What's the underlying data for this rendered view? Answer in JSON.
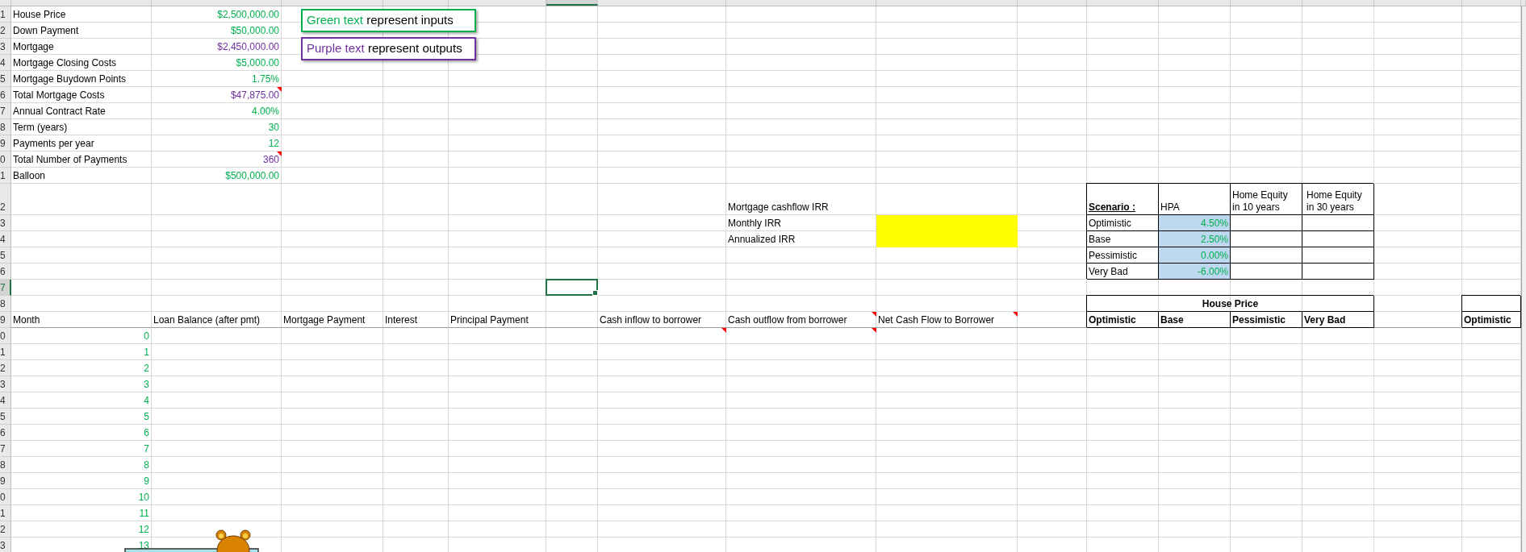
{
  "row_headers": [
    {
      "label": "1",
      "selected": false
    },
    {
      "label": "2",
      "selected": false
    },
    {
      "label": "3",
      "selected": false
    },
    {
      "label": "4",
      "selected": false
    },
    {
      "label": "5",
      "selected": false
    },
    {
      "label": "6",
      "selected": false
    },
    {
      "label": "7",
      "selected": false
    },
    {
      "label": "8",
      "selected": false
    },
    {
      "label": "9",
      "selected": false
    },
    {
      "label": "0",
      "selected": false
    },
    {
      "label": "1",
      "selected": false
    },
    {
      "label": "2",
      "selected": false
    },
    {
      "label": "3",
      "selected": false
    },
    {
      "label": "4",
      "selected": false
    },
    {
      "label": "5",
      "selected": false
    },
    {
      "label": "6",
      "selected": false
    },
    {
      "label": "7",
      "selected": true
    },
    {
      "label": "8",
      "selected": false
    },
    {
      "label": "9",
      "selected": false
    },
    {
      "label": "0",
      "selected": false
    },
    {
      "label": "1",
      "selected": false
    },
    {
      "label": "2",
      "selected": false
    },
    {
      "label": "3",
      "selected": false
    },
    {
      "label": "4",
      "selected": false
    },
    {
      "label": "5",
      "selected": false
    },
    {
      "label": "6",
      "selected": false
    },
    {
      "label": "7",
      "selected": false
    },
    {
      "label": "8",
      "selected": false
    },
    {
      "label": "9",
      "selected": false
    },
    {
      "label": "0",
      "selected": false
    },
    {
      "label": "1",
      "selected": false
    },
    {
      "label": "2",
      "selected": false
    },
    {
      "label": "3",
      "selected": false
    }
  ],
  "legend": [
    {
      "kind": "input",
      "highlight": "Green text",
      "rest": "represent inputs"
    },
    {
      "kind": "output",
      "highlight": "Purple text",
      "rest": "represent outputs"
    }
  ],
  "inputs": [
    {
      "label": "House Price",
      "value": "$2,500,000.00",
      "kind": "input",
      "comment": false
    },
    {
      "label": "Down Payment",
      "value": "$50,000.00",
      "kind": "input",
      "comment": false
    },
    {
      "label": "Mortgage",
      "value": "$2,450,000.00",
      "kind": "output",
      "comment": false
    },
    {
      "label": "Mortgage Closing Costs",
      "value": "$5,000.00",
      "kind": "input",
      "comment": false
    },
    {
      "label": "Mortgage Buydown Points",
      "value": "1.75%",
      "kind": "input",
      "comment": false
    },
    {
      "label": "Total Mortgage Costs",
      "value": "$47,875.00",
      "kind": "output",
      "comment": true
    },
    {
      "label": "Annual Contract Rate",
      "value": "4.00%",
      "kind": "input",
      "comment": false
    },
    {
      "label": "Term (years)",
      "value": "30",
      "kind": "input",
      "comment": false
    },
    {
      "label": "Payments per year",
      "value": "12",
      "kind": "input",
      "comment": false
    },
    {
      "label": "Total Number of Payments",
      "value": "360",
      "kind": "output",
      "comment": true
    },
    {
      "label": "Balloon",
      "value": "$500,000.00",
      "kind": "input",
      "comment": false
    }
  ],
  "irr": {
    "title": "Mortgage cashflow IRR",
    "rows": [
      {
        "label": "Monthly IRR",
        "highlighted": true
      },
      {
        "label": "Annualized IRR",
        "highlighted": true
      }
    ]
  },
  "scenarios": {
    "columns": [
      {
        "label": "Scenario :",
        "kind": "key"
      },
      {
        "label": "HPA",
        "kind": "plain"
      },
      {
        "label": "Home Equity in 10 years",
        "kind": "plain"
      },
      {
        "label": "Home Equity in 30 years",
        "kind": "centered"
      }
    ],
    "rows": [
      {
        "name": "Optimistic",
        "hpa": "4.50%",
        "kind": "input"
      },
      {
        "name": "Base",
        "hpa": "2.50%",
        "kind": "input"
      },
      {
        "name": "Pessimistic",
        "hpa": "0.00%",
        "kind": "input"
      },
      {
        "name": "Very Bad",
        "hpa": "-6.00%",
        "kind": "input"
      }
    ]
  },
  "schedule": {
    "columns": [
      {
        "label": "Month",
        "comment": false,
        "first_cell_comment": false
      },
      {
        "label": "Loan Balance (after pmt)",
        "comment": false,
        "first_cell_comment": false
      },
      {
        "label": "Mortgage Payment",
        "comment": false,
        "first_cell_comment": false
      },
      {
        "label": "Interest",
        "comment": false,
        "first_cell_comment": false
      },
      {
        "label": "Principal Payment",
        "comment": false,
        "first_cell_comment": false
      },
      {
        "label": "Cash inflow to borrower",
        "comment": false,
        "first_cell_comment": true
      },
      {
        "label": "Cash outflow from borrower",
        "comment": true,
        "first_cell_comment": true
      },
      {
        "label": "Net Cash Flow to Borrower",
        "comment": true,
        "first_cell_comment": false
      }
    ],
    "months": [
      {
        "value": "0",
        "kind": "input"
      },
      {
        "value": "1",
        "kind": "input"
      },
      {
        "value": "2",
        "kind": "input"
      },
      {
        "value": "3",
        "kind": "input"
      },
      {
        "value": "4",
        "kind": "input"
      },
      {
        "value": "5",
        "kind": "input"
      },
      {
        "value": "6",
        "kind": "input"
      },
      {
        "value": "7",
        "kind": "input"
      },
      {
        "value": "8",
        "kind": "input"
      },
      {
        "value": "9",
        "kind": "input"
      },
      {
        "value": "10",
        "kind": "input"
      },
      {
        "value": "11",
        "kind": "input"
      },
      {
        "value": "12",
        "kind": "input"
      },
      {
        "value": "13",
        "kind": "input"
      }
    ]
  },
  "house_price": {
    "title": "House Price",
    "columns": [
      "Optimistic",
      "Base",
      "Pessimistic",
      "Very Bad"
    ]
  },
  "extra_table": {
    "columns": [
      "Optimistic"
    ]
  }
}
